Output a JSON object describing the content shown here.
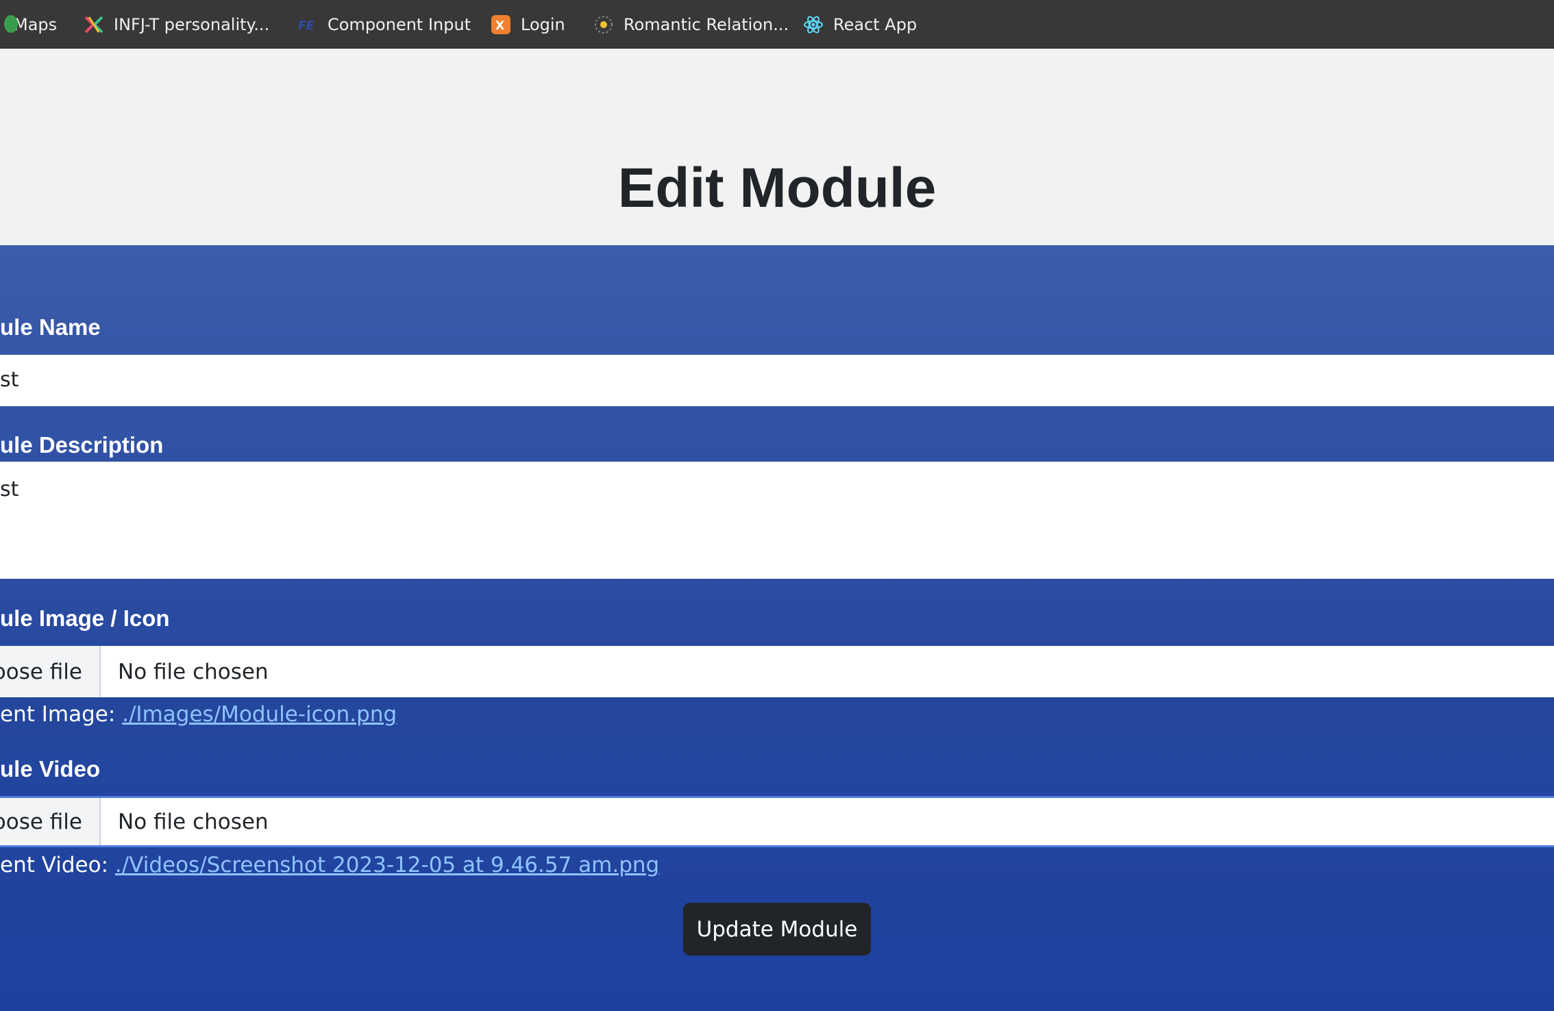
{
  "bookmarks": [
    {
      "label": "Maps",
      "icon": "maps-icon"
    },
    {
      "label": "INFJ-T personality...",
      "icon": "infj-icon"
    },
    {
      "label": "Component Input",
      "icon": "component-icon"
    },
    {
      "label": "Login",
      "icon": "login-icon"
    },
    {
      "label": "Romantic Relation...",
      "icon": "romantic-icon"
    },
    {
      "label": "React App",
      "icon": "react-icon"
    }
  ],
  "page": {
    "title": "Edit Module"
  },
  "form": {
    "name_label": "ule Name",
    "name_value": "st",
    "description_label": "ule Description",
    "description_value": "st",
    "image_label": "ule Image / Icon",
    "image_button": "oose file",
    "image_status": "No file chosen",
    "image_current_prefix": "ent Image: ",
    "image_current_link": "./Images/Module-icon.png",
    "video_label": "ule Video",
    "video_button": "oose file",
    "video_status": "No file chosen",
    "video_current_prefix": "ent Video: ",
    "video_current_link": "./Videos/Screenshot 2023-12-05 at 9.46.57 am.png",
    "submit_label": "Update Module"
  },
  "colors": {
    "bookmark_bar": "#383838",
    "panel_top": "#3c5da9",
    "panel_bottom": "#1e40a0",
    "button_bg": "#212529",
    "link": "#8fc3ff"
  }
}
